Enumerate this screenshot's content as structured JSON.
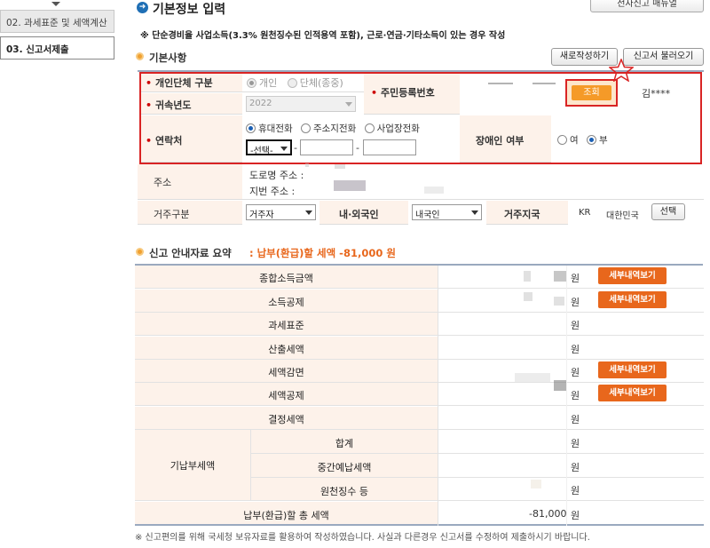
{
  "sidebar": {
    "items": [
      {
        "label": "02. 과세표준 및 세액계산"
      },
      {
        "label": "03. 신고서제출"
      }
    ]
  },
  "header": {
    "title": "기본정보 입력",
    "manual_button": "전자신고 매뉴얼",
    "notice": "※ 단순경비율 사업소득(3.3% 원천징수된 인적용역 포함), 근로·연금·기타소득이 있는 경우 작성"
  },
  "basic": {
    "section_title": "기본사항",
    "new_button": "새로작성하기",
    "load_button": "신고서 불러오기",
    "entity_label": "개인단체 구분",
    "entity_options": [
      "개인",
      "단체(종중)"
    ],
    "year_label": "귀속년도",
    "year_value": "2022",
    "rrn_label": "주민등록번호",
    "search_button": "조회",
    "name_value": "김****",
    "contact_label": "연락처",
    "contact_options": [
      "휴대전화",
      "주소지전화",
      "사업장전화"
    ],
    "contact_select": "-선택-",
    "dash": "-",
    "disability_label": "장애인 여부",
    "disability_options": [
      "여",
      "부"
    ],
    "address_label": "주소",
    "road_address_label": "도로명 주소 :",
    "lot_address_label": "지번 주소 :",
    "residence_type_label": "거주구분",
    "residence_type_value": "거주자",
    "nationality_label": "내·외국인",
    "nationality_value": "내국인",
    "residence_country_label": "거주지국",
    "country_code": "KR",
    "country_name": "대한민국",
    "select_button": "선택"
  },
  "summary": {
    "section_title": "신고 안내자료 요약",
    "result_text": ": 납부(환급)할 세액 -81,000 원",
    "rows": [
      {
        "label": "종합소득금액",
        "unit": "원",
        "detail": "세부내역보기"
      },
      {
        "label": "소득공제",
        "unit": "원",
        "detail": "세부내역보기"
      },
      {
        "label": "과세표준",
        "unit": "원"
      },
      {
        "label": "산출세액",
        "unit": "원"
      },
      {
        "label": "세액감면",
        "unit": "원",
        "detail": "세부내역보기"
      },
      {
        "label": "세액공제",
        "unit": "원",
        "detail": "세부내역보기"
      },
      {
        "label": "결정세액",
        "unit": "원"
      }
    ],
    "prepaid_group_label": "기납부세액",
    "prepaid_rows": [
      {
        "label": "합계",
        "unit": "원"
      },
      {
        "label": "중간예납세액",
        "unit": "원"
      },
      {
        "label": "원천징수 등",
        "unit": "원"
      }
    ],
    "total_label": "납부(환급)할 총 세액",
    "total_value": "-81,000",
    "total_unit": "원"
  },
  "footnote": "※ 신고편의를 위해 국세청 보유자료를 활용하여 작성하였습니다. 사실과 다른경우 신고서를 수정하여 제출하시기 바랍니다.",
  "colors": {
    "accent_orange": "#e8671c",
    "highlight_red": "#d92424",
    "label_bg": "#fdf2ea"
  }
}
